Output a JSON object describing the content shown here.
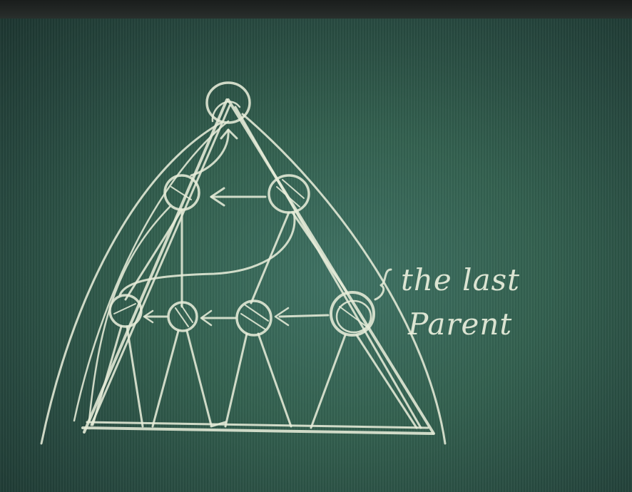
{
  "annotation": {
    "line1": "the last",
    "line2": "Parent"
  },
  "colors": {
    "board": "#33604f",
    "chalk": "#e6ecd8",
    "bezel": "#1a1d1c"
  }
}
